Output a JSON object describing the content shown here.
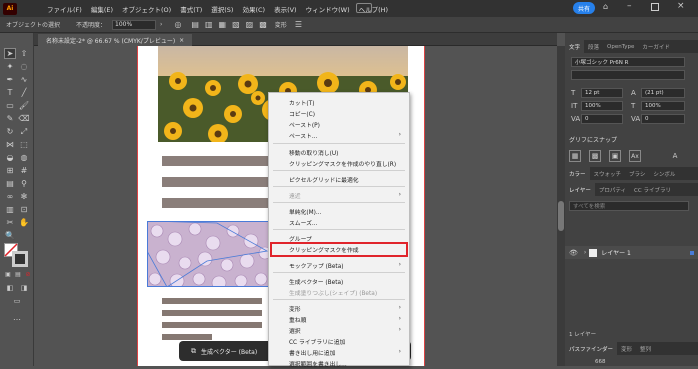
{
  "menubar": {
    "logo": "Ai",
    "items": [
      "ファイル(F)",
      "編集(E)",
      "オブジェクト(O)",
      "書式(T)",
      "選択(S)",
      "効果(C)",
      "表示(V)",
      "ウィンドウ(W)",
      "ヘルプ(H)"
    ],
    "share": "共有"
  },
  "controlbar": {
    "object_state": "オブジェクトの選択",
    "opacity_label": "不透明度：",
    "opacity_value": "100%",
    "transform": "変形"
  },
  "document": {
    "tab_title": "名称未設定-2* @ 66.67 % (CMYK/プレビュー)",
    "close": "×"
  },
  "context_menu": {
    "items": [
      {
        "label": "カット(T)",
        "disabled": false,
        "sub": false
      },
      {
        "label": "コピー(C)",
        "disabled": false,
        "sub": false
      },
      {
        "label": "ペースト(P)",
        "disabled": false,
        "sub": false
      },
      {
        "label": "ペースト...",
        "disabled": false,
        "sub": true
      },
      {
        "label": "移動の取り消し(U)",
        "disabled": false,
        "sub": false
      },
      {
        "label": "クリッピングマスクを作成のやり直し(R)",
        "disabled": false,
        "sub": false
      },
      {
        "label": "ピクセルグリッドに最適化",
        "disabled": false,
        "sub": false
      },
      {
        "label": "遠近",
        "disabled": true,
        "sub": true
      },
      {
        "label": "単純化(M)...",
        "disabled": false,
        "sub": false
      },
      {
        "label": "スムーズ...",
        "disabled": false,
        "sub": false
      },
      {
        "label": "グループ",
        "disabled": false,
        "sub": false
      },
      {
        "label": "クリッピングマスクを作成",
        "disabled": false,
        "sub": false
      },
      {
        "label": "モックアップ (Beta)",
        "disabled": false,
        "sub": true
      },
      {
        "label": "生成ベクター (Beta)",
        "disabled": false,
        "sub": false
      },
      {
        "label": "生成塗りつぶし(シェイプ) (Beta)",
        "disabled": true,
        "sub": false
      },
      {
        "label": "変形",
        "disabled": false,
        "sub": true
      },
      {
        "label": "重ね順",
        "disabled": false,
        "sub": true
      },
      {
        "label": "選択",
        "disabled": false,
        "sub": true
      },
      {
        "label": "CC ライブラリに追加",
        "disabled": false,
        "sub": false
      },
      {
        "label": "書き出し用に追加",
        "disabled": false,
        "sub": true
      },
      {
        "label": "選択範囲を書き出し...",
        "disabled": false,
        "sub": false
      }
    ]
  },
  "taskbar": {
    "label": "生成ベクター (Beta)"
  },
  "right_panel": {
    "char_tabs": [
      "文字",
      "段落",
      "OpenType",
      "カーガイド"
    ],
    "font_name": "小塚ゴシック Pr6N R",
    "font_size": "12 pt",
    "leading": "(21 pt)",
    "hscale": "100%",
    "vscale": "100%",
    "tracking": "0",
    "kerning": "0",
    "glyph_snap_title": "グリフにスナップ",
    "color_tabs": [
      "カラー",
      "スウォッチ",
      "ブラシ",
      "シンボル"
    ],
    "layer_tabs": [
      "レイヤー",
      "プロパティ",
      "CC ライブラリ"
    ],
    "layer_search_placeholder": "すべてを検索",
    "layer_name": "レイヤー 1",
    "layers_footer": "1 レイヤー",
    "bottom_tabs": [
      "パスファインダー",
      "変形",
      "整列"
    ],
    "bottom_value": "668"
  },
  "colors": {
    "accent": "#2680eb",
    "highlight": "#e0242b",
    "menu_bg": "#f2f2f2"
  }
}
